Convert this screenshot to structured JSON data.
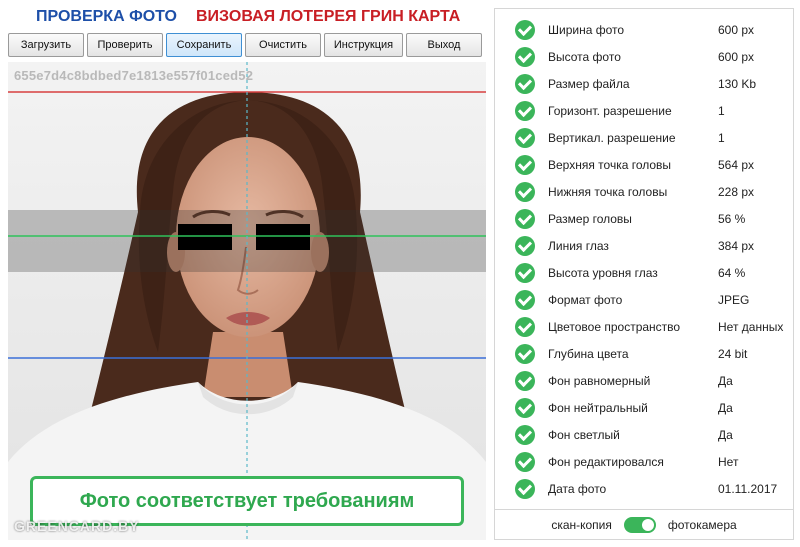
{
  "header": {
    "title_left": "ПРОВЕРКА ФОТО",
    "title_right": "ВИЗОВАЯ ЛОТЕРЕЯ ГРИН КАРТА",
    "colors": {
      "left": "#1d4fa8",
      "right": "#c81e24"
    }
  },
  "toolbar": {
    "buttons": [
      {
        "label": "Загрузить"
      },
      {
        "label": "Проверить"
      },
      {
        "label": "Сохранить",
        "active": true
      },
      {
        "label": "Очистить"
      },
      {
        "label": "Инструкция"
      },
      {
        "label": "Выход"
      }
    ]
  },
  "photo": {
    "hash": "655e7d4c8bdbed7e1813e557f01ced52",
    "status": "Фото соответствует требованиям",
    "watermark": "GREENCARD.BY",
    "guide_colors": {
      "top": "#d8403f",
      "eyes": "#2fc25b",
      "chin": "#3a6fd8",
      "center": "#5bb8c9"
    }
  },
  "params": [
    {
      "label": "Ширина фото",
      "value": "600 px"
    },
    {
      "label": "Высота фото",
      "value": "600 px"
    },
    {
      "label": "Размер файла",
      "value": "130 Kb"
    },
    {
      "label": "Горизонт. разрешение",
      "value": "1"
    },
    {
      "label": "Вертикал. разрешение",
      "value": "1"
    },
    {
      "label": "Верхняя точка головы",
      "value": "564 px"
    },
    {
      "label": "Нижняя точка головы",
      "value": "228 px"
    },
    {
      "label": "Размер головы",
      "value": "56 %"
    },
    {
      "label": "Линия глаз",
      "value": "384 px"
    },
    {
      "label": "Высота уровня глаз",
      "value": "64 %"
    },
    {
      "label": "Формат фото",
      "value": "JPEG"
    },
    {
      "label": "Цветовое пространство",
      "value": "Нет данных"
    },
    {
      "label": "Глубина цвета",
      "value": "24 bit"
    },
    {
      "label": "Фон равномерный",
      "value": "Да"
    },
    {
      "label": "Фон нейтральный",
      "value": "Да"
    },
    {
      "label": "Фон светлый",
      "value": "Да"
    },
    {
      "label": "Фон редактировался",
      "value": "Нет"
    },
    {
      "label": "Дата фото",
      "value": "01.11.2017"
    }
  ],
  "mode": {
    "left": "скан-копия",
    "right": "фотокамера",
    "toggle_on": true,
    "accent": "#3bb55a"
  }
}
